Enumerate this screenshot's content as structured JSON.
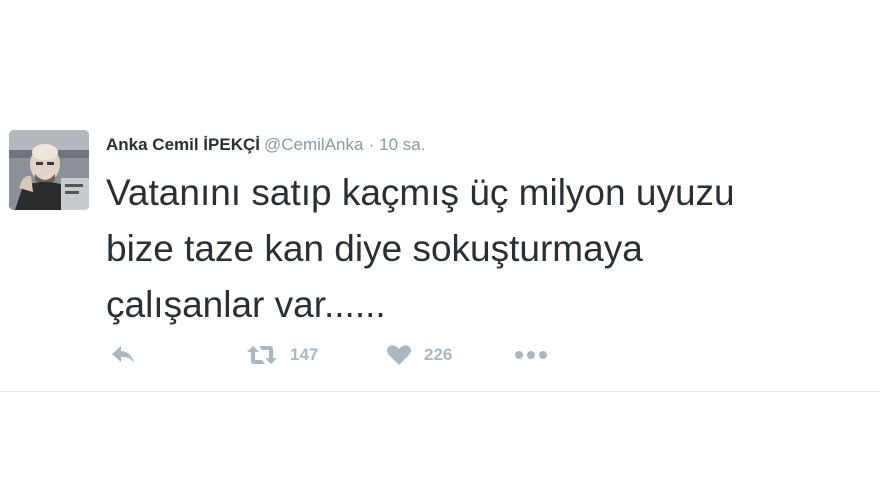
{
  "tweet": {
    "author_name": "Anka Cemil İPEKÇİ",
    "handle": "@CemilAnka",
    "separator": "·",
    "time": "10 sa.",
    "text": "Vatanını satıp kaçmış üç milyon uyuzu\nbize taze kan diye sokuşturmaya\nçalışanlar var......",
    "retweet_count": "147",
    "like_count": "226"
  },
  "icons": {
    "reply": "reply-icon",
    "retweet": "retweet-icon",
    "like": "heart-icon",
    "more": "more-dots-icon"
  },
  "colors": {
    "text": "#292f33",
    "muted": "#8899a6",
    "action": "#aab8c2",
    "divider": "#e1e8ed"
  }
}
